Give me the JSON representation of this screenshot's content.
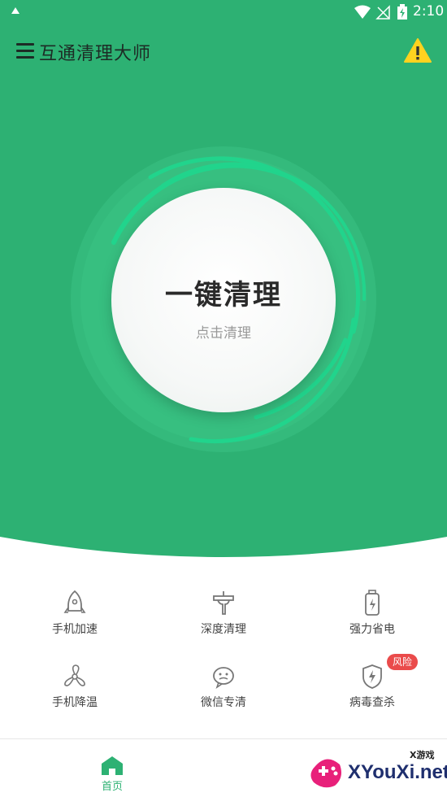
{
  "status_bar": {
    "time": "2:10"
  },
  "app_bar": {
    "title": "互通清理大师"
  },
  "clean": {
    "title": "一键清理",
    "subtitle": "点击清理"
  },
  "features": [
    {
      "label": "手机加速",
      "icon": "rocket-icon"
    },
    {
      "label": "深度清理",
      "icon": "brush-icon"
    },
    {
      "label": "强力省电",
      "icon": "battery-icon"
    },
    {
      "label": "手机降温",
      "icon": "fan-icon"
    },
    {
      "label": "微信专清",
      "icon": "wechat-icon"
    },
    {
      "label": "病毒查杀",
      "icon": "shield-icon"
    }
  ],
  "badge": {
    "label": "风险",
    "color": "#ea4b4b"
  },
  "bottom_nav": {
    "home_label": "首页"
  },
  "watermark": {
    "small": "X游戏",
    "big": "XYouXi.net"
  },
  "colors": {
    "accent": "#2db173",
    "ring": "#1fd38a"
  }
}
